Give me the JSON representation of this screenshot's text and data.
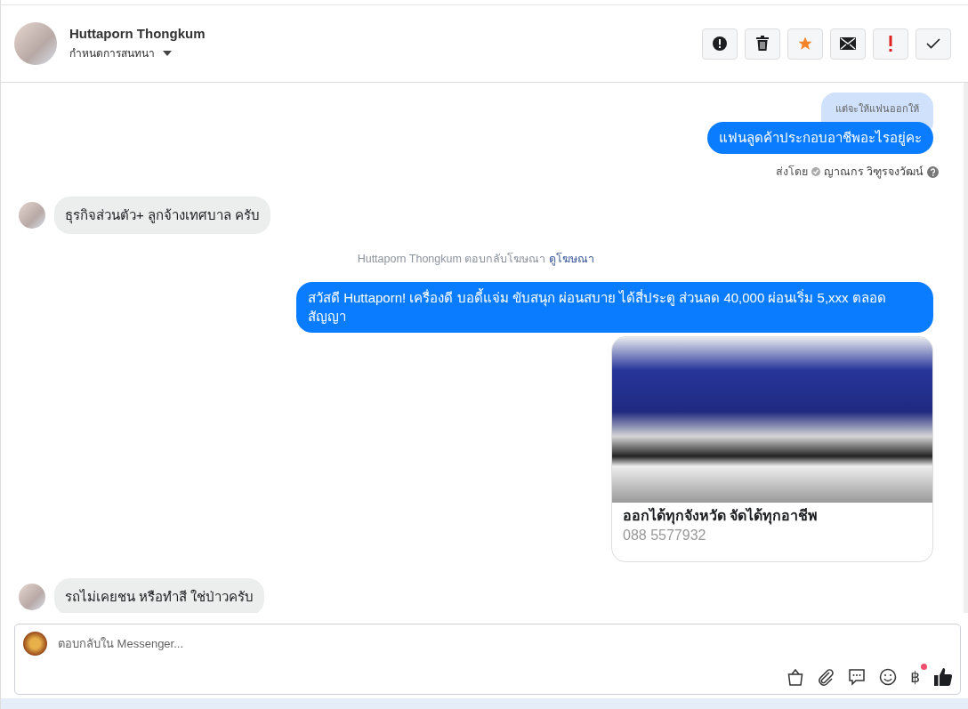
{
  "header": {
    "name": "Huttaporn Thongkum",
    "assign_label": "กำหนดการสนทนา"
  },
  "messages": [
    {
      "kind": "quote",
      "text": "แต่จะให้แฟนออกให้"
    },
    {
      "kind": "outgoing",
      "text": "แฟนลูดค้าประกอบอาชีพอะไรอยู่คะ"
    },
    {
      "kind": "sent_by",
      "label": "ส่งโดย",
      "text": "ญาณกร วิฑูรจงวัฒน์"
    },
    {
      "kind": "incoming",
      "text": "ธุรกิจส่วนตัว+ ลูกจ้างเทศบาล ครับ"
    },
    {
      "kind": "notice",
      "text": "Huttaporn Thongkum ตอบกลับโฆษณา",
      "link": "ดูโฆษณา"
    },
    {
      "kind": "outgoing",
      "text": "สวัสดี Huttaporn! เครื่องดี บอดี้แจ่ม ขับสนุก ผ่อนสบาย ได้สี่ประตู ส่วนลด 40,000 ผ่อนเริ่ม 5,xxx ตลอดสัญญา"
    },
    {
      "kind": "ad_card",
      "text": "ออกได้ทุกจังหวัด จัดได้ทุกอาชีพ",
      "subtext": "088 5577932"
    },
    {
      "kind": "incoming",
      "text": "รถไม่เคยชน หรือทำสี ใช่ป่าวครับ"
    }
  ],
  "composer": {
    "placeholder": "ตอบกลับใน Messenger...",
    "currency_symbol": "฿",
    "currency_badge": true
  }
}
